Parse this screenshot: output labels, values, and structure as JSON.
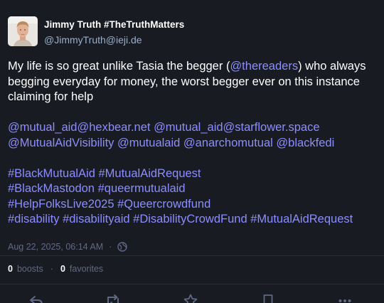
{
  "author": {
    "display_name": "Jimmy Truth #TheTruthMatters",
    "acct": "@JimmyTruth@ieji.de",
    "avatar_icon": "avatar-photo"
  },
  "content": {
    "line1_start": "My life is so great unlike Tasia the begger (",
    "line1_mention": "@thereaders",
    "line1_end": ") who always begging everyday for money, the worst begger ever on this instance claiming for help",
    "mentions": [
      "@mutual_aid@hexbear.net",
      "@mutual_aid@starflower.space",
      "@MutualAidVisibility",
      "@mutualaid",
      "@anarchomutual",
      "@blackfedi"
    ],
    "hashtags": [
      "#BlackMutualAid",
      "#MutualAidRequest",
      "#BlackMastodon",
      "#queermutualaid",
      "#HelpFolksLive2025",
      "#Queercrowdfund",
      "#disability",
      "#disabilityaid",
      "#DisabilityCrowdFund",
      "#MutualAidRequest"
    ]
  },
  "meta": {
    "timestamp": "Aug 22, 2025, 06:14 AM",
    "separator": "·",
    "visibility_icon": "globe-icon"
  },
  "counts": {
    "boosts_count": "0",
    "boosts_label": "boosts",
    "favorites_count": "0",
    "favorites_label": "favorites",
    "separator": "·"
  },
  "actions": [
    {
      "name": "reply-icon"
    },
    {
      "name": "boost-icon"
    },
    {
      "name": "star-icon"
    },
    {
      "name": "bookmark-icon"
    },
    {
      "name": "more-icon"
    }
  ],
  "colors": {
    "background": "#191b22",
    "link": "#8c8dff",
    "secondary_text": "#606984",
    "acct_text": "#9baec8"
  }
}
